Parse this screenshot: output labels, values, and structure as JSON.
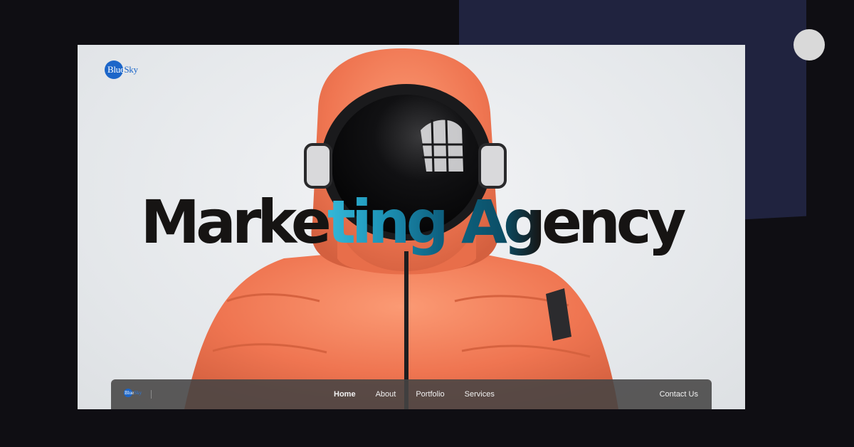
{
  "brand": {
    "logo_text_part1": "Blue",
    "logo_text_part2": "Sky",
    "accent_color": "#1c66c9"
  },
  "hero": {
    "headline_part1": "Marke",
    "headline_part2": "ting",
    "headline_part3": " Ag",
    "headline_part4": "ency",
    "image_subject": "person in orange puffer jacket wearing astronaut helmet"
  },
  "navbar": {
    "logo_text_part1": "Blue",
    "logo_text_part2": "Sky",
    "links": [
      {
        "label": "Home",
        "active": true
      },
      {
        "label": "About",
        "active": false
      },
      {
        "label": "Portfolio",
        "active": false
      },
      {
        "label": "Services",
        "active": false
      }
    ],
    "contact_label": "Contact Us"
  },
  "colors": {
    "background": "#0f0e13",
    "panel": "#20233f",
    "jacket": "#f07a55",
    "headline_accent": "#34b8d8"
  }
}
